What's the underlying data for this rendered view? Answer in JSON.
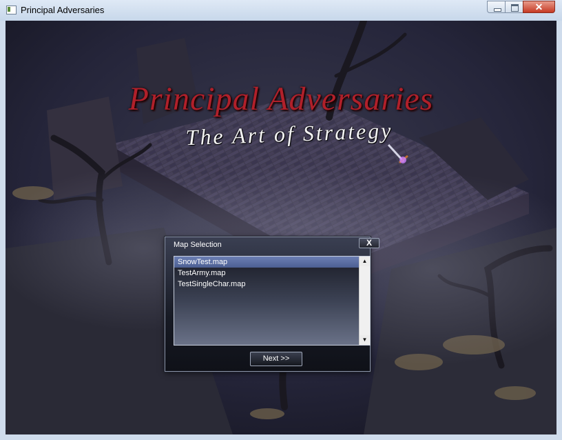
{
  "window": {
    "title": "Principal Adversaries"
  },
  "logo": {
    "title": "Principal Adversaries",
    "subtitle": "The Art of Strategy"
  },
  "dialog": {
    "title": "Map Selection",
    "close_label": "X",
    "maps": [
      "SnowTest.map",
      "TestArmy.map",
      "TestSingleChar.map"
    ],
    "selected_index": 0,
    "next_label": "Next >>"
  },
  "icons": {
    "cursor": "sword-cursor-icon",
    "scroll_up": "scroll-up-arrow-icon",
    "scroll_down": "scroll-down-arrow-icon"
  }
}
